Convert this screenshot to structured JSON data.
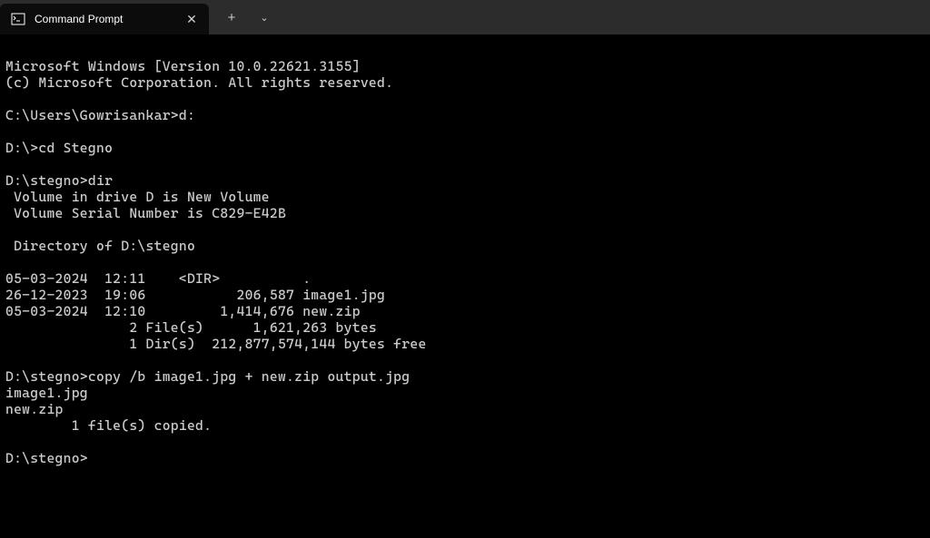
{
  "tab": {
    "title": "Command Prompt"
  },
  "terminal": {
    "lines": {
      "l0": "Microsoft Windows [Version 10.0.22621.3155]",
      "l1": "(c) Microsoft Corporation. All rights reserved.",
      "l2": "",
      "l3": "C:\\Users\\Gowrisankar>d:",
      "l4": "",
      "l5": "D:\\>cd Stegno",
      "l6": "",
      "l7": "D:\\stegno>dir",
      "l8": " Volume in drive D is New Volume",
      "l9": " Volume Serial Number is C829-E42B",
      "l10": "",
      "l11": " Directory of D:\\stegno",
      "l12": "",
      "l13": "05-03-2024  12:11    <DIR>          .",
      "l14": "26-12-2023  19:06           206,587 image1.jpg",
      "l15": "05-03-2024  12:10         1,414,676 new.zip",
      "l16": "               2 File(s)      1,621,263 bytes",
      "l17": "               1 Dir(s)  212,877,574,144 bytes free",
      "l18": "",
      "l19": "D:\\stegno>copy /b image1.jpg + new.zip output.jpg",
      "l20": "image1.jpg",
      "l21": "new.zip",
      "l22": "        1 file(s) copied.",
      "l23": "",
      "l24": "D:\\stegno>"
    }
  }
}
